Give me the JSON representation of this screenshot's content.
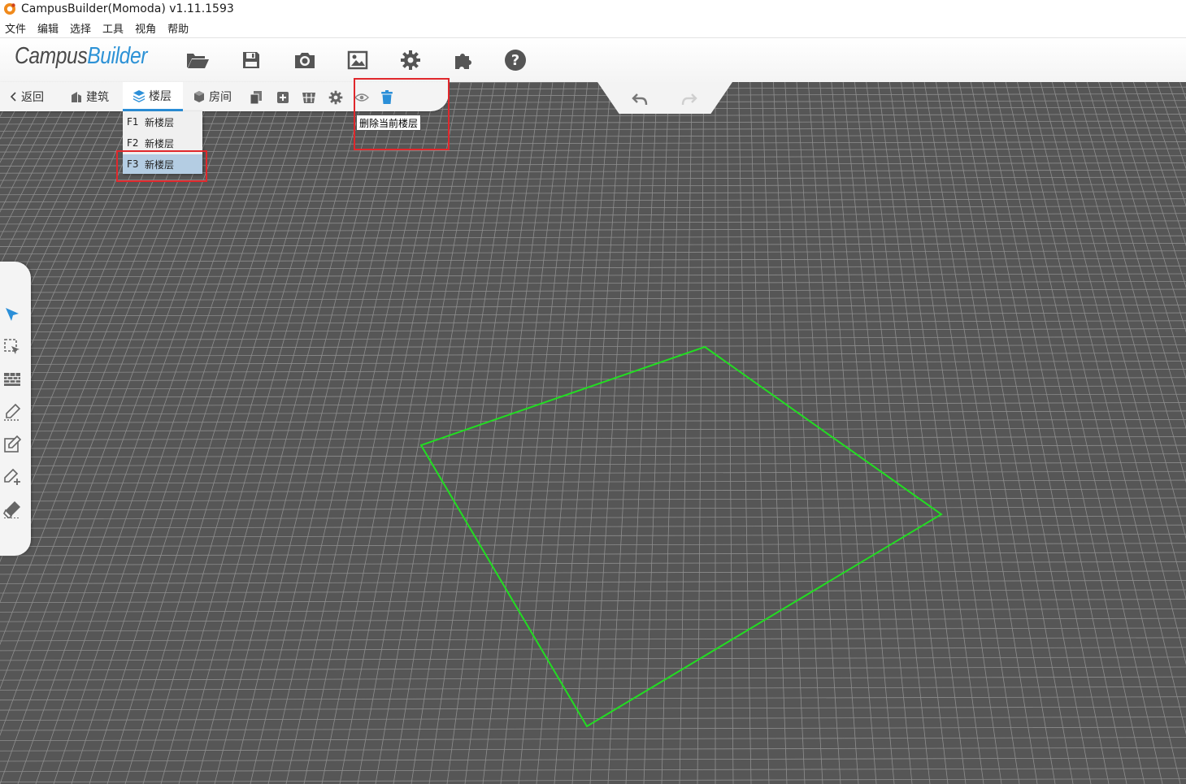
{
  "window": {
    "title": "CampusBuilder(Momoda) v1.11.1593"
  },
  "menu": [
    "文件",
    "编辑",
    "选择",
    "工具",
    "视角",
    "帮助"
  ],
  "logo": {
    "part1": "Campus",
    "part2": "Builder"
  },
  "toolbar_icons": [
    "folder-open-icon",
    "save-icon",
    "camera-icon",
    "image-icon",
    "gear-icon",
    "puzzle-icon",
    "help-icon"
  ],
  "subbar": {
    "back": "返回",
    "building": "建筑",
    "floor": "楼层",
    "room": "房间",
    "icons": [
      "copy-icon",
      "add-icon",
      "shelf-icon",
      "floor-settings-icon",
      "eye-icon",
      "trash-icon"
    ]
  },
  "floors": [
    {
      "code": "F1",
      "name": "新楼层"
    },
    {
      "code": "F2",
      "name": "新楼层"
    },
    {
      "code": "F3",
      "name": "新楼层"
    }
  ],
  "selected_floor": "F3",
  "tooltip": "删除当前楼层",
  "side_tools": [
    "select-arrow-icon",
    "box-select-icon",
    "wall-icon",
    "draw-line-icon",
    "draw-area-icon",
    "add-point-icon",
    "eraser-icon"
  ],
  "colors": {
    "accent": "#2b8fd8",
    "highlight": "#e0282c",
    "floor_outline": "#22dd22",
    "grid_bg": "#565656"
  }
}
